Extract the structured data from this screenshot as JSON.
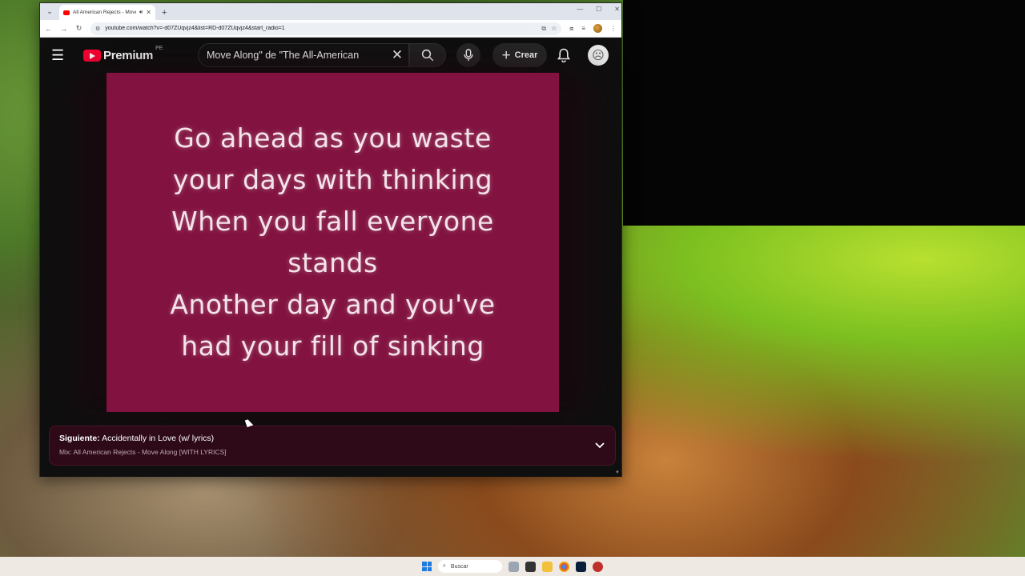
{
  "browser": {
    "tab_title": "All American Rejects - Move",
    "url": "youtube.com/watch?v=-d07ZUqvjz4&list=RD-d07ZUqvjz4&start_radio=1"
  },
  "youtube": {
    "logo_text": "Premium",
    "region": "PE",
    "search_value": "Move Along\" de \"The All-American",
    "create_label": "Crear"
  },
  "video": {
    "lyrics": [
      "Go ahead as you waste",
      "your days with thinking",
      "When you fall everyone",
      "stands",
      "Another day and you've",
      "had your fill of sinking"
    ]
  },
  "up_next": {
    "prefix": "Siguiente:",
    "title": "Accidentally in Love (w/ lyrics)",
    "mix": "Mix: All American Rejects - Move Along [WITH LYRICS]"
  },
  "taskbar": {
    "search_placeholder": "Buscar"
  },
  "colors": {
    "video_bg": "#821340",
    "upnext_bg": "#2e0918",
    "yt_red": "#ff0033"
  }
}
